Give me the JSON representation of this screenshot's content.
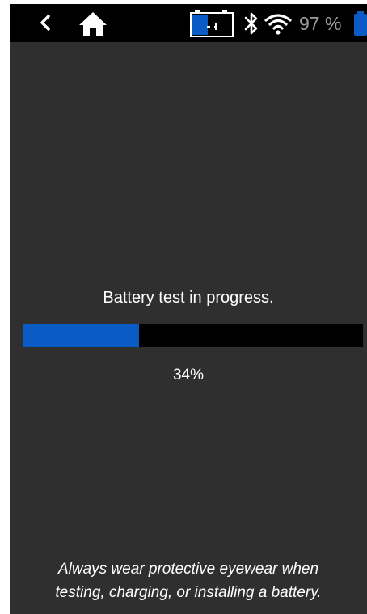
{
  "status_bar": {
    "battery_percent_text": "97 %",
    "battery_level": 0.97,
    "icons": {
      "back": "chevron-left-icon",
      "home": "home-icon",
      "battery_test": "battery-test-icon",
      "bluetooth": "bluetooth-icon",
      "wifi": "wifi-icon",
      "battery": "battery-icon"
    }
  },
  "test": {
    "title": "Battery test in progress.",
    "progress_fraction": 0.34,
    "progress_label": "34%"
  },
  "warning": {
    "line1": "Always wear protective eyewear when",
    "line2": "testing, charging, or installing a battery."
  },
  "colors": {
    "accent_blue": "#0a5bc4",
    "background": "#2f2f2f",
    "status_bar": "#000000",
    "track": "#000000",
    "text": "#ffffff",
    "status_text": "#9e9e9e"
  }
}
